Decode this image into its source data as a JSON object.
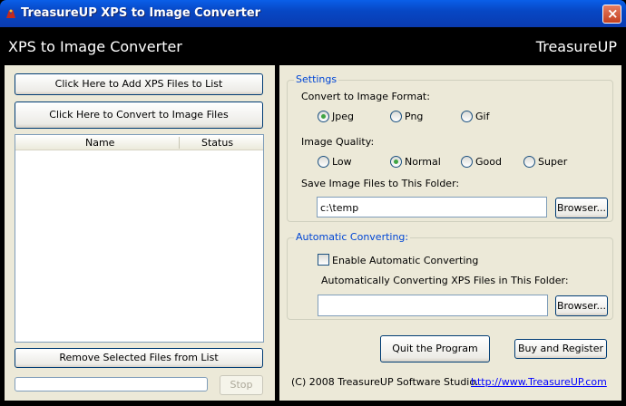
{
  "window": {
    "title": "TreasureUP XPS to Image Converter",
    "close_label": "×"
  },
  "header": {
    "title": "XPS to Image Converter",
    "brand": "TreasureUP"
  },
  "left": {
    "add_button": "Click Here to Add XPS Files to List",
    "convert_button": "Click Here to Convert to Image Files",
    "list_columns": [
      "Name",
      "Status"
    ],
    "list_rows": [],
    "remove_button": "Remove Selected Files from List",
    "stop_button": "Stop",
    "progress": 0
  },
  "settings": {
    "group_label": "Settings",
    "format_label": "Convert to Image Format:",
    "formats": [
      {
        "label": "Jpeg",
        "selected": true
      },
      {
        "label": "Png",
        "selected": false
      },
      {
        "label": "Gif",
        "selected": false
      }
    ],
    "quality_label": "Image Quality:",
    "qualities": [
      {
        "label": "Low",
        "selected": false
      },
      {
        "label": "Normal",
        "selected": true
      },
      {
        "label": "Good",
        "selected": false
      },
      {
        "label": "Super",
        "selected": false
      }
    ],
    "folder_label": "Save Image Files to This Folder:",
    "folder_value": "c:\\temp",
    "browse_label": "Browser..."
  },
  "auto": {
    "group_label": "Automatic Converting:",
    "enable_label": "Enable Automatic Converting",
    "enabled": false,
    "folder_label": "Automatically Converting XPS Files in This Folder:",
    "folder_value": "",
    "browse_label": "Browser..."
  },
  "footer": {
    "quit_button": "Quit the Program",
    "buy_button": "Buy and Register",
    "copyright": "(C) 2008 TreasureUP Software Studio.",
    "website": "http://www.TreasureUP.com"
  },
  "colors": {
    "titlebar": "#0747c4",
    "header_bg": "#000000",
    "panel_bg": "#ece9d8",
    "group_label": "#0046d5",
    "selected_radio": "#3fa442"
  }
}
